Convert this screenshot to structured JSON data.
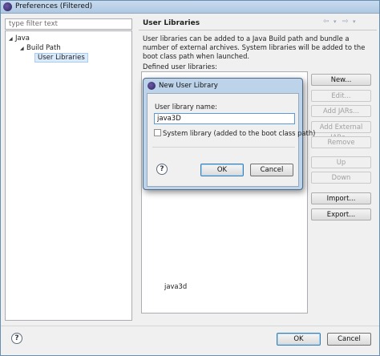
{
  "window": {
    "title": "Preferences (Filtered)"
  },
  "filter": {
    "placeholder": "type filter text"
  },
  "tree": {
    "items": [
      {
        "label": "Java",
        "expanded": true
      },
      {
        "label": "Build Path",
        "expanded": true
      },
      {
        "label": "User Libraries",
        "selected": true
      }
    ]
  },
  "page": {
    "title": "User Libraries",
    "description": "User libraries can be added to a Java Build path and bundle a number of external archives. System libraries will be added to the boot class path when launched.",
    "defined_label": "Defined user libraries:",
    "library_entry": "java3d"
  },
  "nav": {
    "back": "⇦",
    "back_menu": "▾",
    "forward": "⇨",
    "forward_menu": "▾"
  },
  "buttons": {
    "new": "New...",
    "edit": "Edit...",
    "add_jars": "Add JARs...",
    "add_external_jars": "Add External JARs...",
    "remove": "Remove",
    "up": "Up",
    "down": "Down",
    "import": "Import...",
    "export": "Export..."
  },
  "footer": {
    "help": "?",
    "ok": "OK",
    "cancel": "Cancel"
  },
  "dialog": {
    "title": "New User Library",
    "name_label": "User library name:",
    "name_value": "java3D",
    "system_checkbox": "System library (added to the boot class path)",
    "system_checked": false,
    "help": "?",
    "ok": "OK",
    "cancel": "Cancel"
  },
  "colors": {
    "accent": "#3c7fb1",
    "selection": "#dcebfc"
  }
}
